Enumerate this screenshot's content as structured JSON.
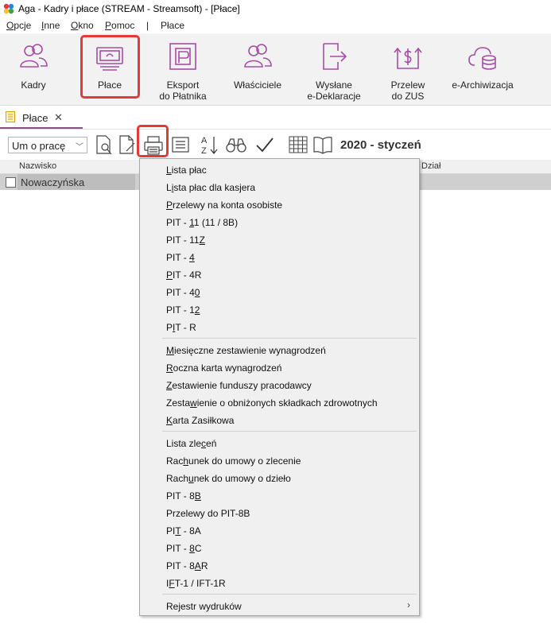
{
  "window": {
    "title": "Aga - Kadry i płace (STREAM - Streamsoft) - [Płace]"
  },
  "menu": {
    "opcje": {
      "u": "O",
      "rest": "pcje"
    },
    "inne": {
      "u": "I",
      "rest": "nne"
    },
    "okno": {
      "u": "O",
      "rest": "kno"
    },
    "pomoc": {
      "u": "P",
      "rest": "omoc"
    },
    "sep": "|",
    "place": "Płace"
  },
  "ribbon": {
    "kadry": "Kadry",
    "place": "Płace",
    "eksport": [
      "Eksport",
      "do Płatnika"
    ],
    "wlasciciele": "Właściciele",
    "wyslane": [
      "Wysłane",
      "e-Deklaracje"
    ],
    "przelew": [
      "Przelew",
      "do ZUS"
    ],
    "earchiwizacja": "e-Archiwizacja"
  },
  "tab": {
    "label": "Płace",
    "close": "✕"
  },
  "toolbar": {
    "combo_value": "Um o pracę",
    "combo_arrow": "﹀",
    "period": "2020 - styczeń",
    "sort_a": "A",
    "sort_z": "Z"
  },
  "grid": {
    "columns": {
      "nazwisko": "Nazwisko",
      "dzial": "Dział"
    },
    "rows": [
      {
        "nazwisko": "Nowaczyńska"
      }
    ]
  },
  "dropdown": {
    "items": [
      {
        "pre": "",
        "u": "L",
        "post": "ista płac"
      },
      {
        "pre": "L",
        "u": "i",
        "post": "sta płac dla kasjera"
      },
      {
        "pre": "",
        "u": "P",
        "post": "rzelewy na konta osobiste"
      },
      {
        "pre": "PIT - ",
        "u": "1",
        "post": "1 (11 / 8B)"
      },
      {
        "pre": "PIT - 11",
        "u": "Z",
        "post": ""
      },
      {
        "pre": "PIT - ",
        "u": "4",
        "post": ""
      },
      {
        "pre": "",
        "u": "P",
        "post": "IT - 4R"
      },
      {
        "pre": "PIT - 4",
        "u": "0",
        "post": ""
      },
      {
        "pre": "PIT - 1",
        "u": "2",
        "post": ""
      },
      {
        "pre": "P",
        "u": "I",
        "post": "T - R"
      },
      {
        "pre": "",
        "u": "M",
        "post": "iesięczne zestawienie wynagrodzeń"
      },
      {
        "pre": "",
        "u": "R",
        "post": "oczna karta wynagrodzeń"
      },
      {
        "pre": "",
        "u": "Z",
        "post": "estawienie funduszy pracodawcy"
      },
      {
        "pre": "Zesta",
        "u": "w",
        "post": "ienie o obniżonych składkach zdrowotnych"
      },
      {
        "pre": "",
        "u": "K",
        "post": "arta Zasiłkowa"
      },
      {
        "pre": "Lista zle",
        "u": "c",
        "post": "eń"
      },
      {
        "pre": "Rac",
        "u": "h",
        "post": "unek do umowy o zlecenie"
      },
      {
        "pre": "Rach",
        "u": "u",
        "post": "nek do umowy o dzieło"
      },
      {
        "pre": "PIT - 8",
        "u": "B",
        "post": ""
      },
      {
        "pre": "Przelewy do PIT-8B",
        "u": "",
        "post": ""
      },
      {
        "pre": "PI",
        "u": "T",
        "post": " - 8A"
      },
      {
        "pre": "PIT - ",
        "u": "8",
        "post": "C"
      },
      {
        "pre": "PIT - 8",
        "u": "A",
        "post": "R"
      },
      {
        "pre": "I",
        "u": "F",
        "post": "T-1 / IFT-1R"
      },
      {
        "pre": "Rejestr wydruków",
        "u": "",
        "post": ""
      }
    ],
    "submenu_arrow": "›"
  },
  "colors": {
    "accent": "#a64ca6",
    "highlight": "#e53935",
    "ribbon_bg": "#f2f2f2"
  }
}
